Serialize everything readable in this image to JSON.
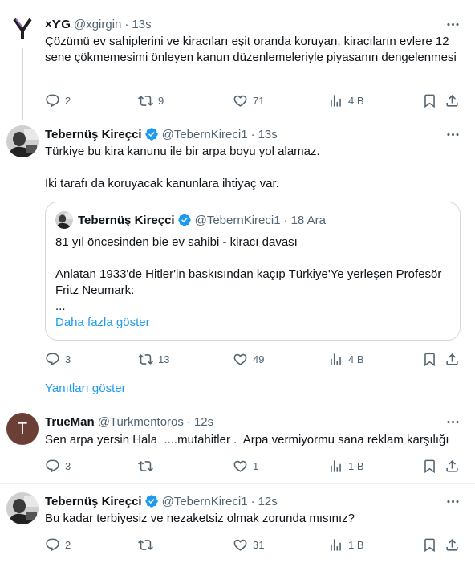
{
  "tweets": [
    {
      "name": "×ƳG",
      "handle": "@xgirgin",
      "time": "13s",
      "text": "Çözümü ev sahiplerini ve kiracıları eşit oranda koruyan, kiracıların evlere 12 sene çökmemesimi önleyen kanun düzenlemeleriyle piyasanın dengelenmesi",
      "replies": "2",
      "retweets": "9",
      "likes": "71",
      "views": "4 B"
    },
    {
      "name": "Tebernüş Kireçci",
      "handle": "@TebernKireci1",
      "time": "13s",
      "text_line1": "Türkiye bu kira kanunu ile bir arpa boyu yol alamaz.",
      "text_line2": "İki tarafı da koruyacak kanunlara ihtiyaç var.",
      "quote": {
        "name": "Tebernüş Kireçci",
        "handle": "@TebernKireci1",
        "time": "18 Ara",
        "line1": "81 yıl öncesinden bie ev sahibi - kiracı davası",
        "line2": "Anlatan 1933'de Hitler'in baskısından kaçıp Türkiye'Ye yerleşen Profesör Fritz Neumark:",
        "line3": "...",
        "show_more": "Daha fazla göster"
      },
      "replies": "3",
      "retweets": "13",
      "likes": "49",
      "views": "4 B"
    },
    {
      "name": "TrueMan",
      "handle": "@Turkmentoros",
      "time": "12s",
      "avatar_letter": "T",
      "text": "Sen arpa yersin Hala  ....mutahitler .  Arpa vermiyormu sana reklam karşılığı",
      "replies": "3",
      "retweets": "",
      "likes": "1",
      "views": "1 B"
    },
    {
      "name": "Tebernüş Kireçci",
      "handle": "@TebernKireci1",
      "time": "12s",
      "text": "Bu kadar terbiyesiz ve nezaketsiz olmak zorunda mısınız?",
      "replies": "2",
      "retweets": "",
      "likes": "31",
      "views": "1 B"
    }
  ],
  "show_replies": "Yanıtları göster",
  "dot": "·",
  "colors": {
    "text": "#0f1419",
    "muted": "#536471",
    "link": "#1d9bf0",
    "border": "#cfd9de",
    "avatar_trueman": "#6b3f35"
  },
  "icons": [
    "reply-icon",
    "retweet-icon",
    "like-icon",
    "views-icon",
    "bookmark-icon",
    "share-icon",
    "more-icon",
    "verified-icon"
  ]
}
